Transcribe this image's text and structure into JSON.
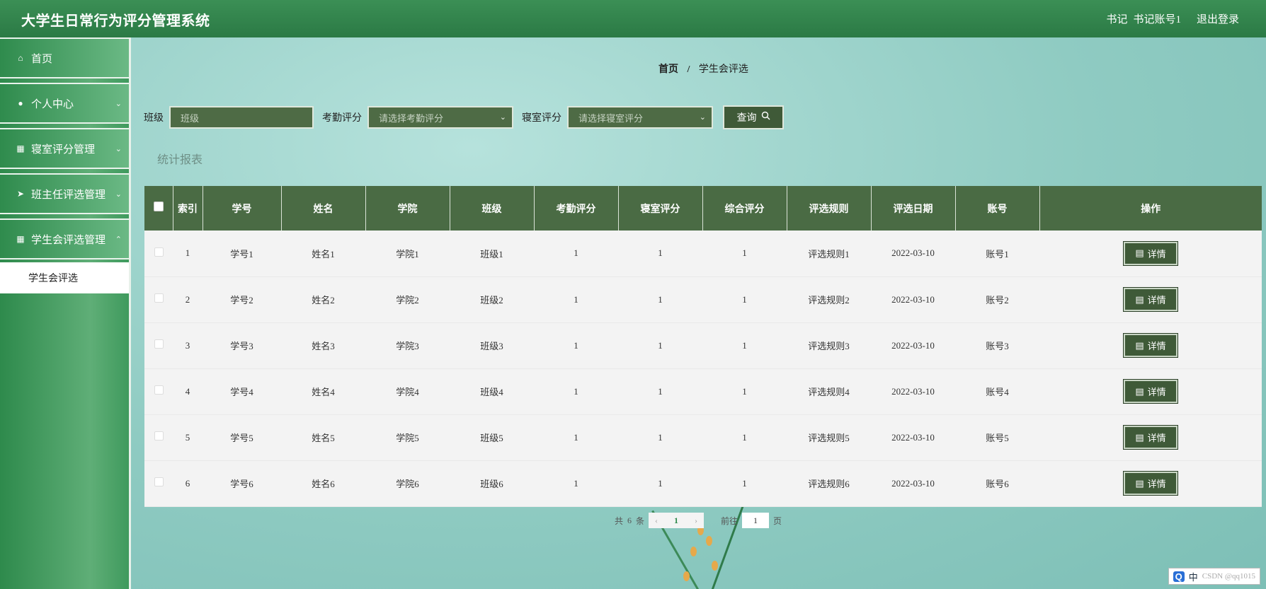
{
  "header": {
    "title": "大学生日常行为评分管理系统",
    "role": "书记",
    "account": "书记账号1",
    "logout": "退出登录"
  },
  "sidebar": {
    "items": [
      {
        "label": "首页",
        "icon": "home-icon"
      },
      {
        "label": "个人中心",
        "icon": "user-icon"
      },
      {
        "label": "寝室评分管理",
        "icon": "grid-icon"
      },
      {
        "label": "班主任评选管理",
        "icon": "send-icon"
      },
      {
        "label": "学生会评选管理",
        "icon": "grid-icon"
      }
    ],
    "subitem": "学生会评选"
  },
  "breadcrumb": {
    "home": "首页",
    "separator": "/",
    "current": "学生会评选"
  },
  "filters": {
    "class_label": "班级",
    "class_placeholder": "班级",
    "attendance_label": "考勤评分",
    "attendance_placeholder": "请选择考勤评分",
    "dorm_label": "寝室评分",
    "dorm_placeholder": "请选择寝室评分",
    "search_label": "查询"
  },
  "report_link": "统计报表",
  "table": {
    "headers": {
      "index": "索引",
      "student_id": "学号",
      "name": "姓名",
      "college": "学院",
      "class": "班级",
      "attendance": "考勤评分",
      "dorm": "寝室评分",
      "overall": "综合评分",
      "rule": "评选规则",
      "date": "评选日期",
      "account": "账号",
      "action": "操作"
    },
    "detail_label": "详情",
    "rows": [
      {
        "index": "1",
        "student_id": "学号1",
        "name": "姓名1",
        "college": "学院1",
        "class": "班级1",
        "attendance": "1",
        "dorm": "1",
        "overall": "1",
        "rule": "评选规则1",
        "date": "2022-03-10",
        "account": "账号1"
      },
      {
        "index": "2",
        "student_id": "学号2",
        "name": "姓名2",
        "college": "学院2",
        "class": "班级2",
        "attendance": "1",
        "dorm": "1",
        "overall": "1",
        "rule": "评选规则2",
        "date": "2022-03-10",
        "account": "账号2"
      },
      {
        "index": "3",
        "student_id": "学号3",
        "name": "姓名3",
        "college": "学院3",
        "class": "班级3",
        "attendance": "1",
        "dorm": "1",
        "overall": "1",
        "rule": "评选规则3",
        "date": "2022-03-10",
        "account": "账号3"
      },
      {
        "index": "4",
        "student_id": "学号4",
        "name": "姓名4",
        "college": "学院4",
        "class": "班级4",
        "attendance": "1",
        "dorm": "1",
        "overall": "1",
        "rule": "评选规则4",
        "date": "2022-03-10",
        "account": "账号4"
      },
      {
        "index": "5",
        "student_id": "学号5",
        "name": "姓名5",
        "college": "学院5",
        "class": "班级5",
        "attendance": "1",
        "dorm": "1",
        "overall": "1",
        "rule": "评选规则5",
        "date": "2022-03-10",
        "account": "账号5"
      },
      {
        "index": "6",
        "student_id": "学号6",
        "name": "姓名6",
        "college": "学院6",
        "class": "班级6",
        "attendance": "1",
        "dorm": "1",
        "overall": "1",
        "rule": "评选规则6",
        "date": "2022-03-10",
        "account": "账号6"
      }
    ]
  },
  "pagination": {
    "total_prefix": "共",
    "total": "6",
    "total_suffix": "条",
    "current_page": "1",
    "goto_prefix": "前往",
    "goto_value": "1",
    "goto_suffix": "页"
  },
  "ime": {
    "brand": "Q",
    "mode": "中"
  },
  "watermark": "CSDN @qq1015"
}
